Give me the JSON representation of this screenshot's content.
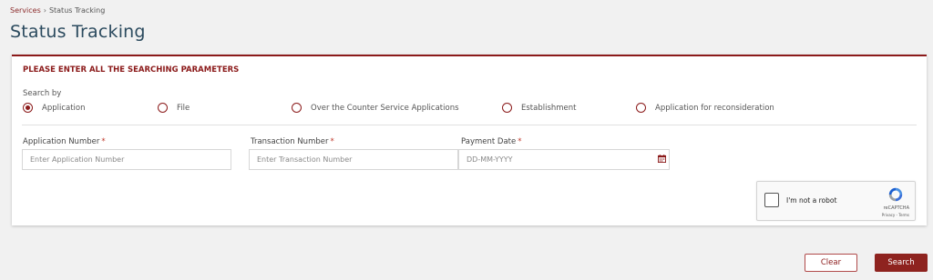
{
  "breadcrumb": {
    "parent": "Services",
    "separator": "›",
    "current": "Status Tracking"
  },
  "page_title": "Status Tracking",
  "card": {
    "heading": "PLEASE ENTER ALL THE SEARCHING PARAMETERS",
    "search_by_label": "Search by",
    "search_options": [
      {
        "label": "Application",
        "selected": true
      },
      {
        "label": "File",
        "selected": false
      },
      {
        "label": "Over the Counter Service Applications",
        "selected": false
      },
      {
        "label": "Establishment",
        "selected": false
      },
      {
        "label": "Application for reconsideration",
        "selected": false
      }
    ],
    "fields": {
      "application_number": {
        "label": "Application Number",
        "required_mark": "*",
        "placeholder": "Enter Application Number",
        "value": ""
      },
      "transaction_number": {
        "label": "Transaction Number",
        "required_mark": "*",
        "placeholder": "Enter Transaction Number",
        "value": ""
      },
      "payment_date": {
        "label": "Payment Date",
        "required_mark": "*",
        "placeholder": "DD-MM-YYYY",
        "value": "",
        "icon": "calendar-icon"
      }
    },
    "captcha": {
      "label": "I'm not a robot",
      "brand": "reCAPTCHA",
      "links": "Privacy - Terms",
      "checked": false
    }
  },
  "buttons": {
    "clear_label": "Clear",
    "search_label": "Search"
  },
  "colors": {
    "accent": "#8b1a1a",
    "title": "#2b4a5e",
    "page_bg": "#f1f1f1"
  }
}
